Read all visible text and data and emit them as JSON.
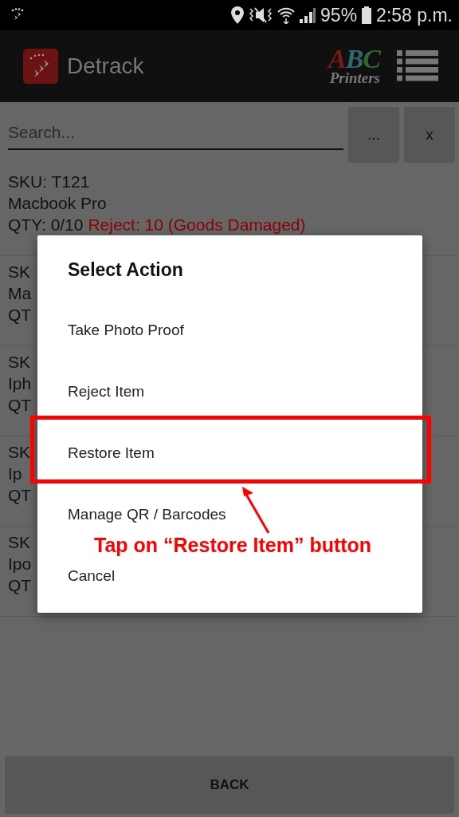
{
  "status_bar": {
    "battery": "95%",
    "time": "2:58 p.m."
  },
  "app_bar": {
    "title": "Detrack",
    "brand_letters": [
      {
        "text": "A",
        "color": "#7a1a1a"
      },
      {
        "text": "B",
        "color": "#2f6670"
      },
      {
        "text": "C",
        "color": "#2e6a2e"
      }
    ],
    "brand_subtitle": "Printers"
  },
  "search": {
    "placeholder": "Search...",
    "buttons": [
      "...",
      "x"
    ]
  },
  "items": [
    {
      "lines": [
        "SKU: T121",
        "Macbook Pro"
      ],
      "qty": "QTY: 0/10",
      "reject": "Reject: 10 (Goods Damaged)"
    },
    {
      "lines": [
        "SK",
        "Ma"
      ],
      "qty": "QT"
    },
    {
      "lines": [
        "SK",
        "Iph"
      ],
      "qty": "QT"
    },
    {
      "lines": [
        "SK",
        "Ip"
      ],
      "qty": "QT"
    },
    {
      "lines": [
        "SK",
        "Ipo"
      ],
      "qty": "QT"
    }
  ],
  "back_button": "BACK",
  "dialog": {
    "title": "Select Action",
    "options": [
      "Take Photo Proof",
      "Reject Item",
      "Restore Item",
      "Manage QR / Barcodes",
      "Cancel"
    ]
  },
  "annotation": {
    "text": "Tap on “Restore Item” button"
  }
}
